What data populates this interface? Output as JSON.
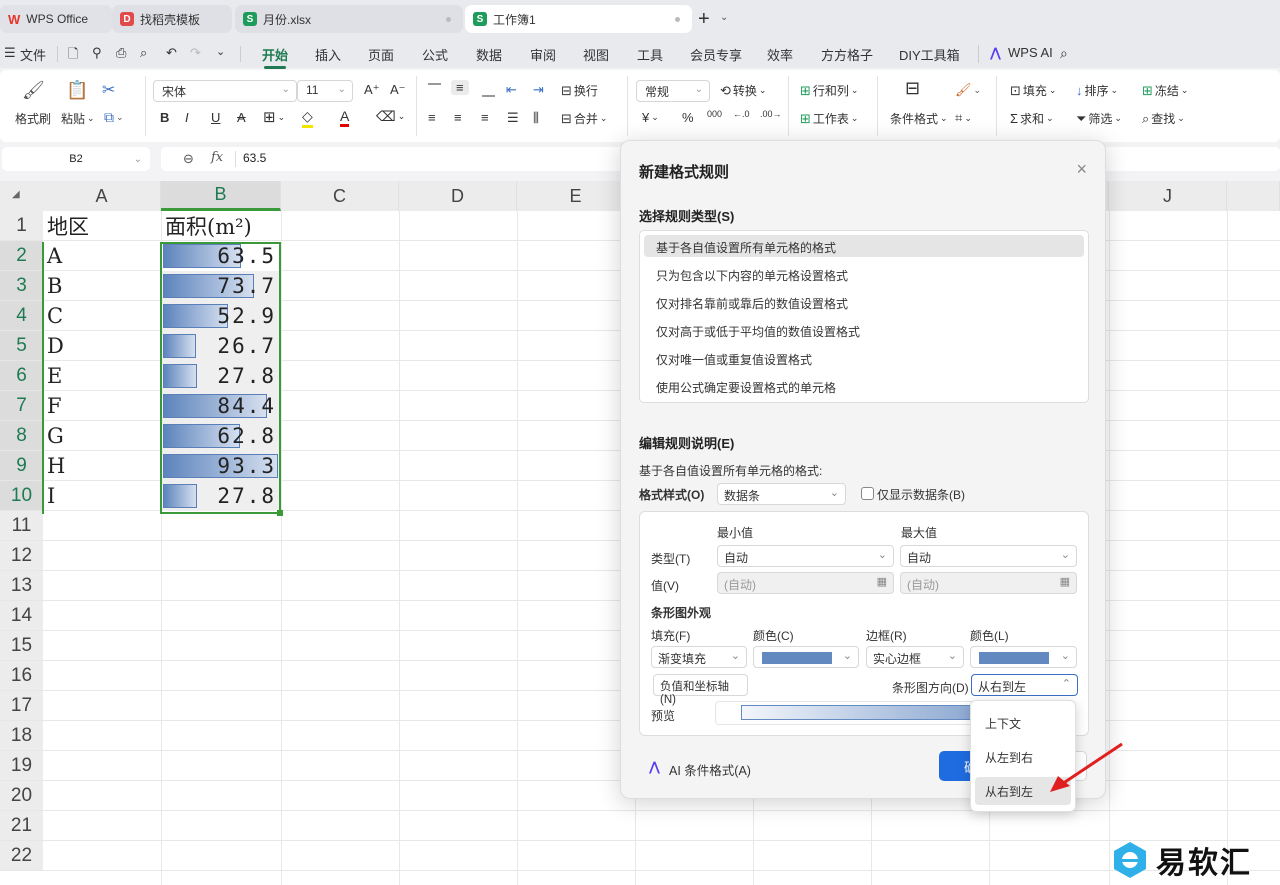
{
  "tabs": [
    {
      "label": "WPS Office",
      "icon": "wps-logo-icon",
      "color": "#e8322a"
    },
    {
      "label": "找稻壳模板",
      "icon": "docer-icon",
      "color": "#e24a4a"
    },
    {
      "label": "月份.xlsx",
      "icon": "spreadsheet-icon",
      "color": "#1f9c5b"
    },
    {
      "label": "工作簿1",
      "icon": "spreadsheet-icon",
      "color": "#1f9c5b",
      "active": true
    }
  ],
  "new_tab": "+",
  "menu": {
    "file": "文件",
    "items": [
      "开始",
      "插入",
      "页面",
      "公式",
      "数据",
      "审阅",
      "视图",
      "工具",
      "会员专享",
      "效率",
      "方方格子",
      "DIY工具箱"
    ],
    "active": "开始",
    "wps_ai": "WPS AI"
  },
  "ribbon": {
    "format_painter": "格式刷",
    "paste": "粘贴",
    "font_name": "宋体",
    "font_size": "11",
    "wrap": "换行",
    "merge": "合并",
    "number_format": "常规",
    "convert": "转换",
    "rows_cols": "行和列",
    "worksheet": "工作表",
    "conditional_format": "条件格式",
    "fill": "填充",
    "sort": "排序",
    "freeze": "冻结",
    "sum": "求和",
    "filter": "筛选",
    "find": "查找",
    "bold": "B",
    "italic": "I",
    "underline": "U",
    "strike": "A",
    "currency": "¥",
    "percent": "%",
    "thousands": "000"
  },
  "formula_bar": {
    "name_box": "B2",
    "fx": "fx",
    "value": "63.5"
  },
  "sheet": {
    "columns": [
      "A",
      "B",
      "C",
      "D",
      "E",
      "",
      "",
      "",
      "",
      "J"
    ],
    "selected_column": "B",
    "rows": [
      "1",
      "2",
      "3",
      "4",
      "5",
      "6",
      "7",
      "8",
      "9",
      "10",
      "11",
      "12",
      "13",
      "14",
      "15",
      "16",
      "17",
      "18",
      "19",
      "20",
      "21",
      "22"
    ],
    "header": {
      "a": "地区",
      "b": "面积(m²)"
    },
    "data": [
      {
        "region": "A",
        "area": "63.5",
        "value": 63.5
      },
      {
        "region": "B",
        "area": "73.7",
        "value": 73.7
      },
      {
        "region": "C",
        "area": "52.9",
        "value": 52.9
      },
      {
        "region": "D",
        "area": "26.7",
        "value": 26.7
      },
      {
        "region": "E",
        "area": "27.8",
        "value": 27.8
      },
      {
        "region": "F",
        "area": "84.4",
        "value": 84.4
      },
      {
        "region": "G",
        "area": "62.8",
        "value": 62.8
      },
      {
        "region": "H",
        "area": "93.3",
        "value": 93.3
      },
      {
        "region": "I",
        "area": "27.8",
        "value": 27.8
      }
    ],
    "bar_color": "#5d84bd"
  },
  "dialog": {
    "title": "新建格式规则",
    "rule_type_label": "选择规则类型(S)",
    "rule_types": [
      "基于各自值设置所有单元格的格式",
      "只为包含以下内容的单元格设置格式",
      "仅对排名靠前或靠后的数值设置格式",
      "仅对高于或低于平均值的数值设置格式",
      "仅对唯一值或重复值设置格式",
      "使用公式确定要设置格式的单元格"
    ],
    "selected_rule": 0,
    "edit_label": "编辑规则说明(E)",
    "edit_desc": "基于各自值设置所有单元格的格式:",
    "format_style_label": "格式样式(O)",
    "format_style": "数据条",
    "only_bar_label": "仅显示数据条(B)",
    "only_bar_checked": false,
    "min_label": "最小值",
    "max_label": "最大值",
    "type_label": "类型(T)",
    "min_type": "自动",
    "max_type": "自动",
    "value_label": "值(V)",
    "min_value": "(自动)",
    "max_value": "(自动)",
    "appearance_label": "条形图外观",
    "fill_label": "填充(F)",
    "fill": "渐变填充",
    "color_label": "颜色(C)",
    "fill_color": "#6389c1",
    "border_label": "边框(R)",
    "border": "实心边框",
    "border_color_label": "颜色(L)",
    "border_color": "#6389c1",
    "negative_axis": "负值和坐标轴(N)",
    "direction_label": "条形图方向(D)",
    "direction": "从右到左",
    "preview_label": "预览",
    "ai_label": "AI 条件格式(A)",
    "ok": "确定",
    "close": "×"
  },
  "direction_menu": {
    "options": [
      "上下文",
      "从左到右",
      "从右到左"
    ],
    "highlighted": 2
  },
  "watermark": "易软汇"
}
